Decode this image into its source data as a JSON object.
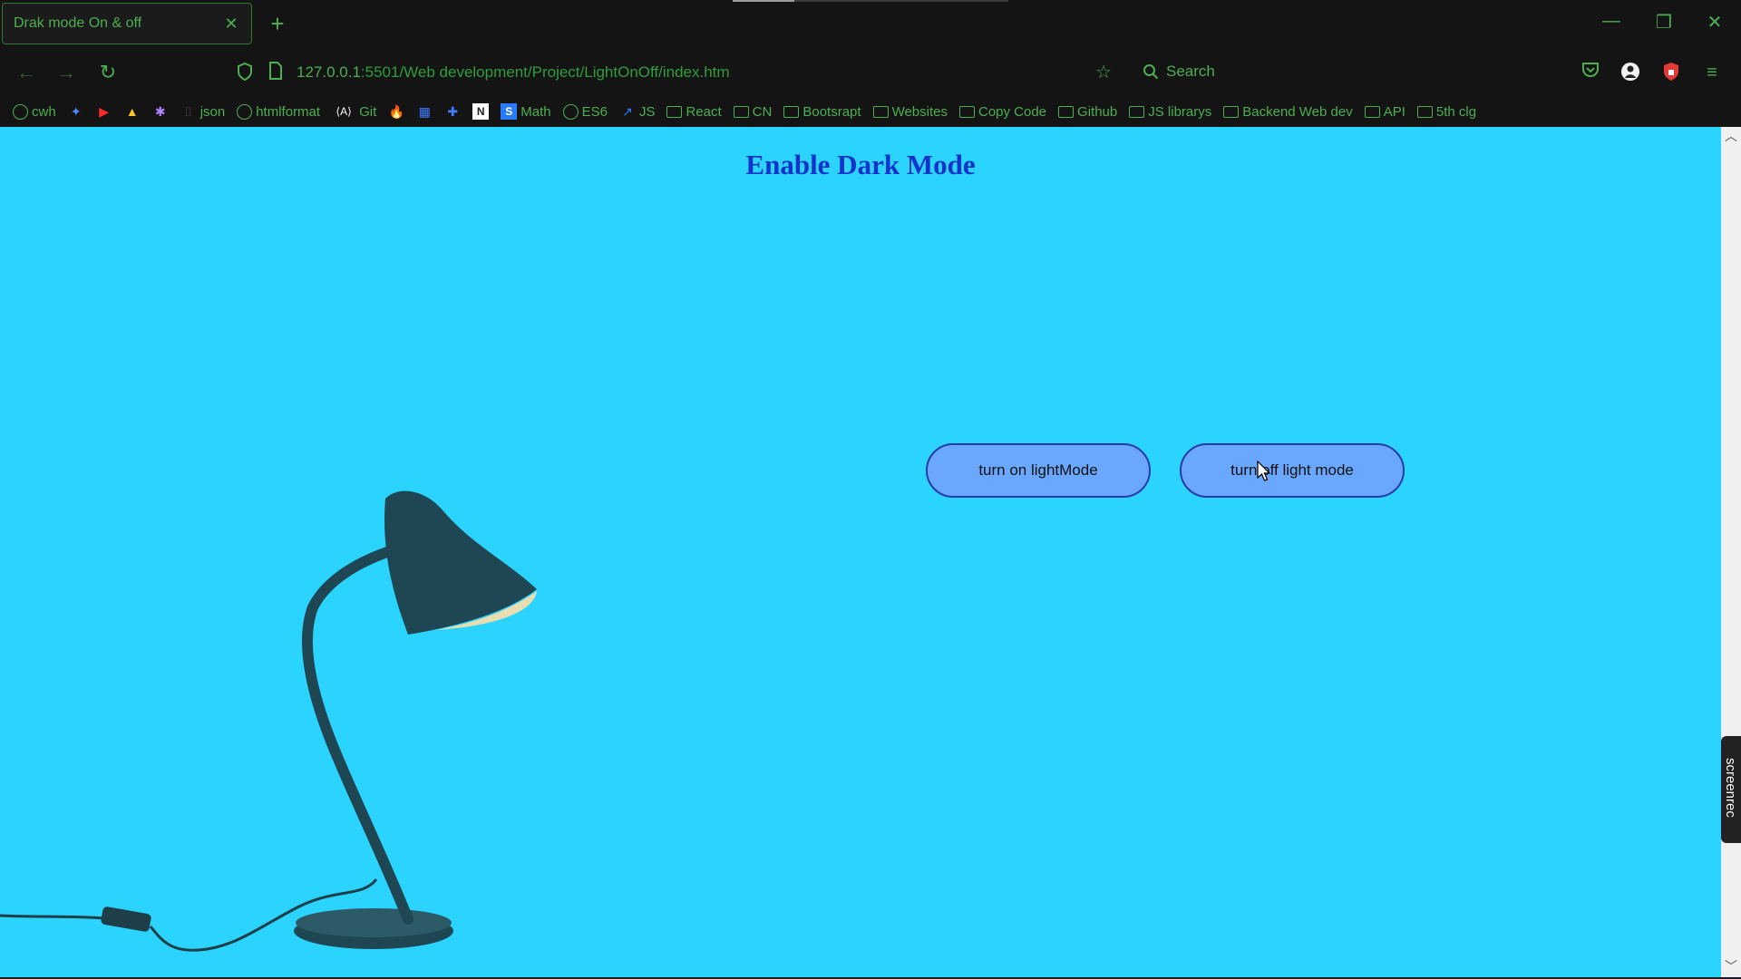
{
  "tab": {
    "title": "Drak mode On & off",
    "close": "✕",
    "new": "+"
  },
  "window": {
    "minimize": "—",
    "restore": "❐",
    "close": "✕"
  },
  "nav": {
    "back": "←",
    "forward": "→",
    "reload": "↻",
    "url_host": "127.0.0.1",
    "url_rest": ":5501/Web development/Project/LightOnOff/index.htm",
    "search_placeholder": "Search"
  },
  "bookmarks": [
    {
      "icon": "globe",
      "label": "cwh"
    },
    {
      "icon": "app",
      "label": ""
    },
    {
      "icon": "youtube",
      "label": ""
    },
    {
      "icon": "drive",
      "label": ""
    },
    {
      "icon": "app2",
      "label": ""
    },
    {
      "icon": "json",
      "label": "json"
    },
    {
      "icon": "globe",
      "label": "htmlformat"
    },
    {
      "icon": "code",
      "label": "Git"
    },
    {
      "icon": "fire",
      "label": ""
    },
    {
      "icon": "app3",
      "label": ""
    },
    {
      "icon": "app4",
      "label": ""
    },
    {
      "icon": "notion",
      "label": ""
    },
    {
      "icon": "math",
      "label": "Math"
    },
    {
      "icon": "globe",
      "label": "ES6"
    },
    {
      "icon": "js",
      "label": "JS"
    },
    {
      "icon": "folder",
      "label": "React"
    },
    {
      "icon": "folder",
      "label": "CN"
    },
    {
      "icon": "folder",
      "label": "Bootsrapt"
    },
    {
      "icon": "folder",
      "label": "Websites"
    },
    {
      "icon": "folder",
      "label": "Copy Code"
    },
    {
      "icon": "folder",
      "label": "Github"
    },
    {
      "icon": "folder",
      "label": "JS librarys"
    },
    {
      "icon": "folder",
      "label": "Backend Web dev"
    },
    {
      "icon": "folder",
      "label": "API"
    },
    {
      "icon": "folder",
      "label": "5th clg"
    }
  ],
  "page": {
    "heading": "Enable Dark Mode",
    "btn_on": "turn on lightMode",
    "btn_off": "turn off light mode"
  },
  "overlay": {
    "screenrec": "screenrec"
  },
  "colors": {
    "accent": "#4caf50",
    "page_bg": "#2bd4ff",
    "button_bg": "#6aa8ff",
    "heading": "#1133cc"
  }
}
